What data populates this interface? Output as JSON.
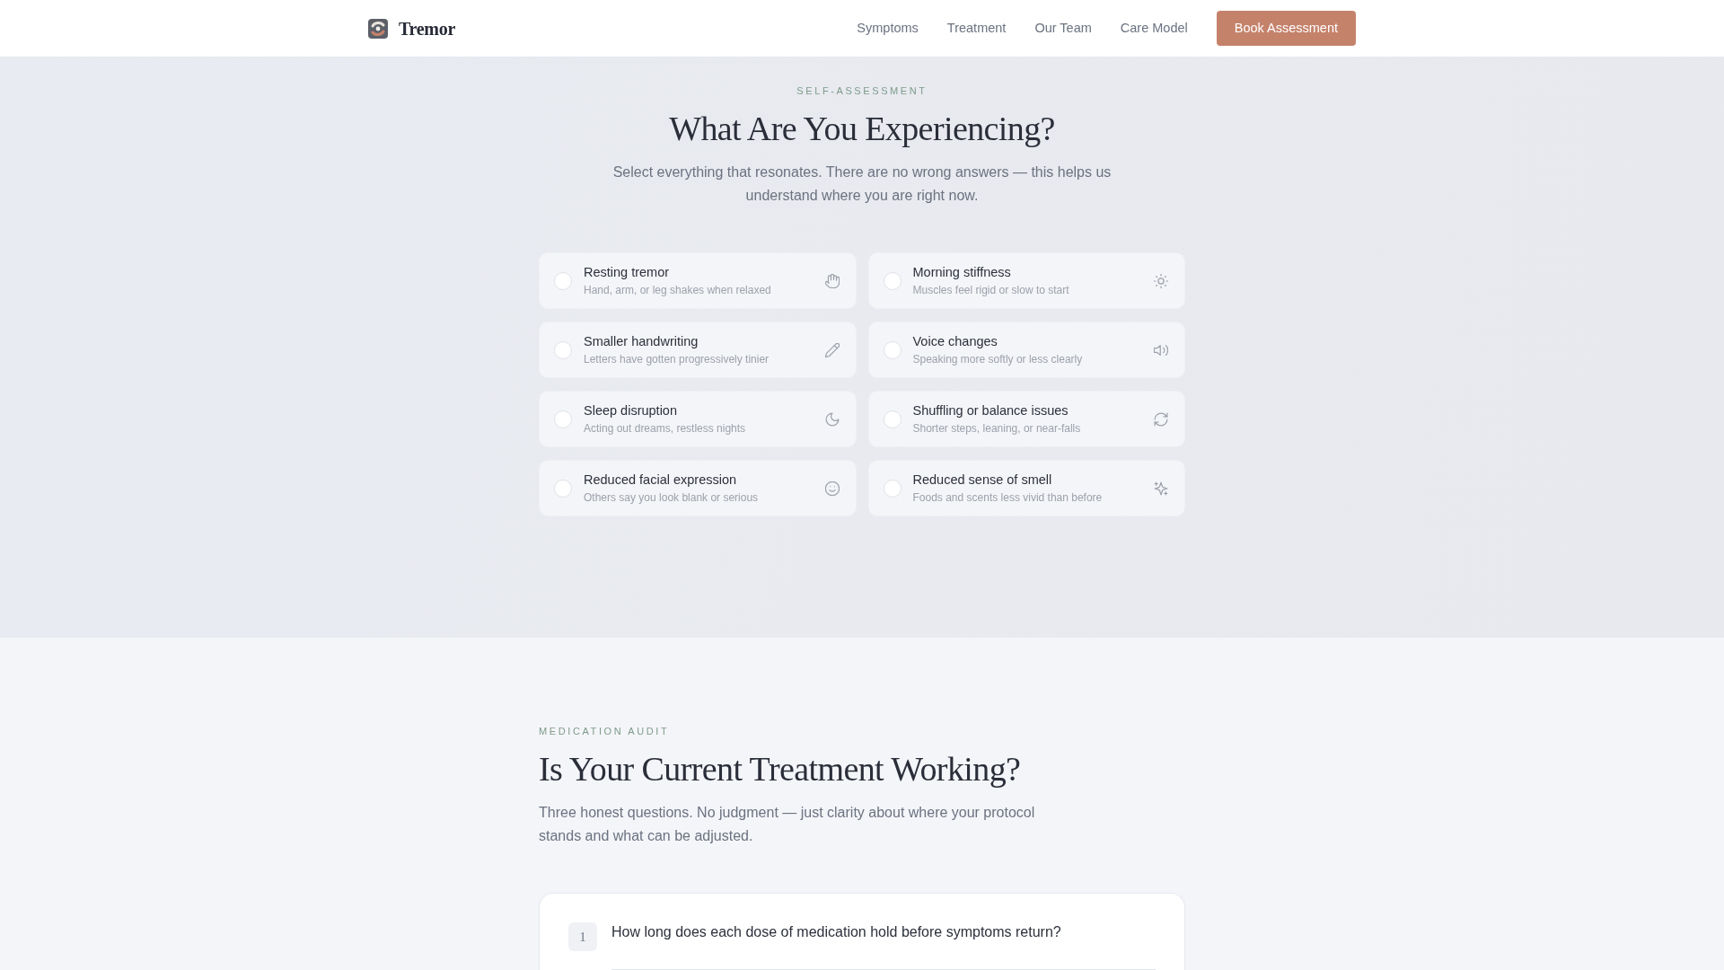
{
  "navbar": {
    "brand": "Tremor",
    "links": [
      {
        "label": "Symptoms"
      },
      {
        "label": "Treatment"
      },
      {
        "label": "Our Team"
      },
      {
        "label": "Care Model"
      }
    ],
    "cta": "Book Assessment"
  },
  "self_assessment": {
    "eyebrow": "SELF-ASSESSMENT",
    "title": "What Are You Experiencing?",
    "intro": "Select everything that resonates. There are no wrong answers — this helps us understand where you are right now.",
    "symptoms": [
      {
        "title": "Resting tremor",
        "description": "Hand, arm, or leg shakes when relaxed",
        "selected": false
      },
      {
        "title": "Morning stiffness",
        "description": "Muscles feel rigid or slow to start",
        "selected": false
      },
      {
        "title": "Smaller handwriting",
        "description": "Letters have gotten progressively tinier",
        "selected": false
      },
      {
        "title": "Voice changes",
        "description": "Speaking more softly or less clearly",
        "selected": false
      },
      {
        "title": "Sleep disruption",
        "description": "Acting out dreams, restless nights",
        "selected": false
      },
      {
        "title": "Shuffling or balance issues",
        "description": "Shorter steps, leaning, or near-falls",
        "selected": false
      },
      {
        "title": "Reduced facial expression",
        "description": "Others say you look blank or serious",
        "selected": false
      },
      {
        "title": "Reduced sense of smell",
        "description": "Foods and scents less vivid than before",
        "selected": false
      }
    ]
  },
  "medication_audit": {
    "eyebrow": "MEDICATION AUDIT",
    "title": "Is Your Current Treatment Working?",
    "intro": "Three honest questions. No judgment — just clarity about where your protocol stands and what can be adjusted.",
    "questions": [
      {
        "number": "1",
        "text": "How long does each dose of medication hold before symptoms return?"
      }
    ]
  }
}
